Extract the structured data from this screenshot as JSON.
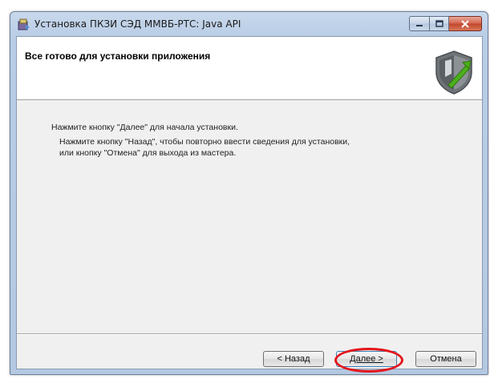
{
  "window": {
    "title": "Установка ПКЗИ СЭД ММВБ-РТС: Java API",
    "buttons": {
      "minimize": "minimize-icon",
      "maximize": "maximize-icon",
      "close": "close-icon"
    }
  },
  "banner": {
    "title": "Все готово для установки приложения",
    "icon": "shield-icon"
  },
  "content": {
    "line1": "Нажмите кнопку \"Далее\" для начала установки.",
    "line2": "Нажмите кнопку \"Назад\", чтобы повторно ввести сведения для установки,",
    "line3": "или кнопку \"Отмена\" для выхода из мастера."
  },
  "footer": {
    "back_label": "< Назад",
    "next_label": "Далее >",
    "cancel_label": "Отмена"
  },
  "colors": {
    "highlight": "#e3151b",
    "title_bar": "#b9cde6",
    "shield_green": "#4caf1c"
  }
}
